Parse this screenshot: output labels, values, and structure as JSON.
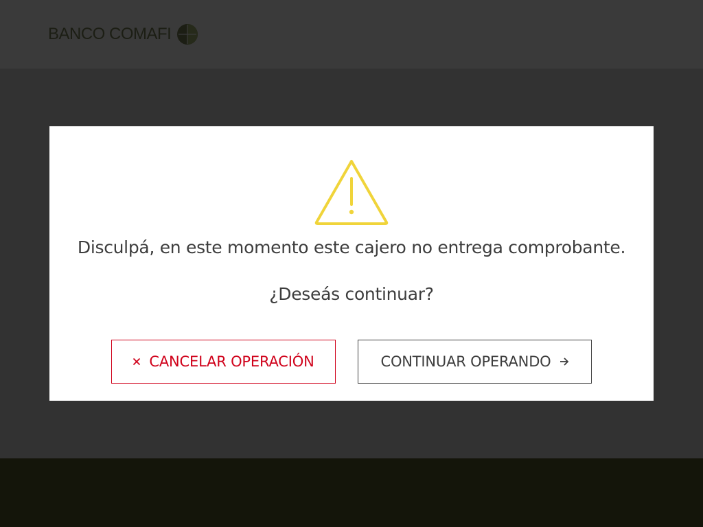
{
  "header": {
    "logo_text": "BANCO COMAFI",
    "logo_icon": "comafi-globe-logo"
  },
  "dialog": {
    "icon": "warning-triangle-icon",
    "message": "Disculpá, en este momento este cajero no entrega comprobante.",
    "question": "¿Deseás continuar?",
    "cancel_button": {
      "label": "CANCELAR OPERACIÓN",
      "icon": "close-icon"
    },
    "continue_button": {
      "label": "CONTINUAR OPERANDO",
      "icon": "arrow-right-icon"
    }
  },
  "colors": {
    "background": "#323232",
    "header": "#3a3a3a",
    "footer": "#14150a",
    "dialog": "#ffffff",
    "warning": "#f0d43a",
    "cancel": "#d0021b",
    "text": "#3d3d3d"
  }
}
